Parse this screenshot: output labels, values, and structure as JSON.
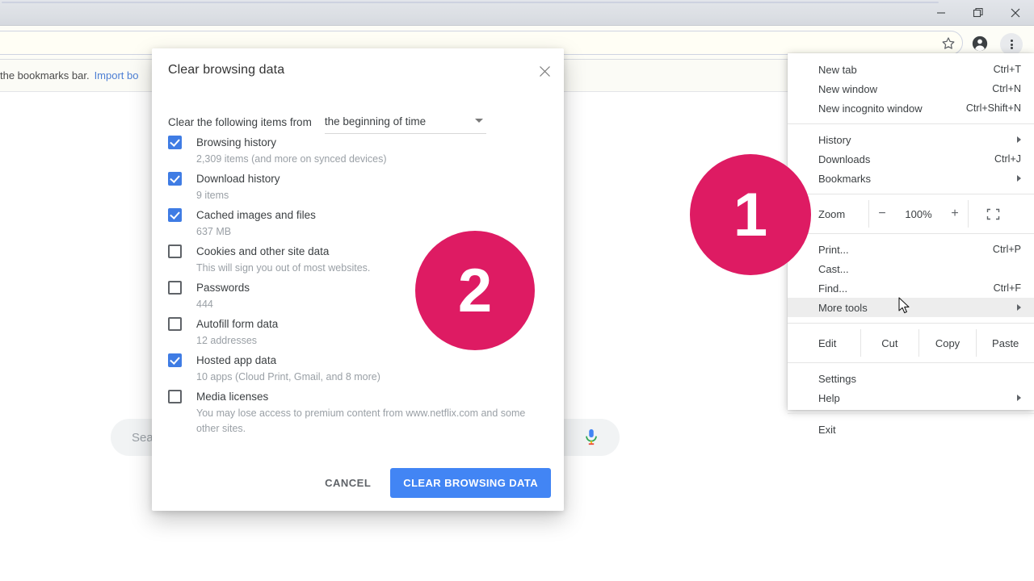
{
  "window": {
    "controls": [
      {
        "name": "minimize",
        "glyph": "minimize-icon"
      },
      {
        "name": "restore",
        "glyph": "restore-icon"
      },
      {
        "name": "close",
        "glyph": "close-icon"
      }
    ]
  },
  "toolbar": {
    "star_icon": "star-icon",
    "avatar_icon": "profile-avatar-icon",
    "menu_icon": "three-dot-menu-icon"
  },
  "bookmarks_bar": {
    "text": "the bookmarks bar.",
    "link": "Import bo"
  },
  "page": {
    "search": {
      "placeholder": "Search",
      "mic_icon": "microphone-icon"
    }
  },
  "dialog": {
    "title": "Clear browsing data",
    "close_icon": "close-icon",
    "period_label": "Clear the following items from",
    "period_value": "the beginning of time",
    "period_caret": "chevron-down-icon",
    "items": [
      {
        "label": "Browsing history",
        "sub": "2,309 items (and more on synced devices)",
        "checked": true
      },
      {
        "label": "Download history",
        "sub": "9 items",
        "checked": true
      },
      {
        "label": "Cached images and files",
        "sub": "637 MB",
        "checked": true
      },
      {
        "label": "Cookies and other site data",
        "sub": "This will sign you out of most websites.",
        "checked": false
      },
      {
        "label": "Passwords",
        "sub": "444",
        "checked": false
      },
      {
        "label": "Autofill form data",
        "sub": "12 addresses",
        "checked": false
      },
      {
        "label": "Hosted app data",
        "sub": "10 apps (Cloud Print, Gmail, and 8 more)",
        "checked": true
      },
      {
        "label": "Media licenses",
        "sub": "You may lose access to premium content from www.netflix.com and some other sites.",
        "checked": false
      }
    ],
    "cancel_label": "CANCEL",
    "confirm_label": "CLEAR BROWSING DATA",
    "confirm_color": "#4285f4"
  },
  "menu": {
    "groups": [
      {
        "type": "items",
        "items": [
          {
            "label": "New tab",
            "accel": "Ctrl+T",
            "submenu": false
          },
          {
            "label": "New window",
            "accel": "Ctrl+N",
            "submenu": false
          },
          {
            "label": "New incognito window",
            "accel": "Ctrl+Shift+N",
            "submenu": false
          }
        ]
      },
      {
        "type": "items",
        "items": [
          {
            "label": "History",
            "accel": "",
            "submenu": true
          },
          {
            "label": "Downloads",
            "accel": "Ctrl+J",
            "submenu": false
          },
          {
            "label": "Bookmarks",
            "accel": "",
            "submenu": true
          }
        ]
      },
      {
        "type": "zoom",
        "label": "Zoom",
        "minus": "−",
        "value": "100%",
        "plus": "+",
        "fullscreen_icon": "fullscreen-icon"
      },
      {
        "type": "items",
        "items": [
          {
            "label": "Print...",
            "accel": "Ctrl+P",
            "submenu": false
          },
          {
            "label": "Cast...",
            "accel": "",
            "submenu": false
          },
          {
            "label": "Find...",
            "accel": "Ctrl+F",
            "submenu": false
          },
          {
            "label": "More tools",
            "accel": "",
            "submenu": true,
            "highlighted": true
          }
        ]
      },
      {
        "type": "edit",
        "label": "Edit",
        "cut": "Cut",
        "copy": "Copy",
        "paste": "Paste"
      },
      {
        "type": "items",
        "items": [
          {
            "label": "Settings",
            "accel": "",
            "submenu": false
          },
          {
            "label": "Help",
            "accel": "",
            "submenu": true
          }
        ]
      },
      {
        "type": "items",
        "items": [
          {
            "label": "Exit",
            "accel": "",
            "submenu": false
          }
        ]
      }
    ]
  },
  "badges": {
    "color": "#DE1B63",
    "items": [
      {
        "id": "badge-1",
        "label": "1"
      },
      {
        "id": "badge-2",
        "label": "2"
      }
    ]
  },
  "cursor": {
    "icon": "mouse-pointer-icon"
  }
}
